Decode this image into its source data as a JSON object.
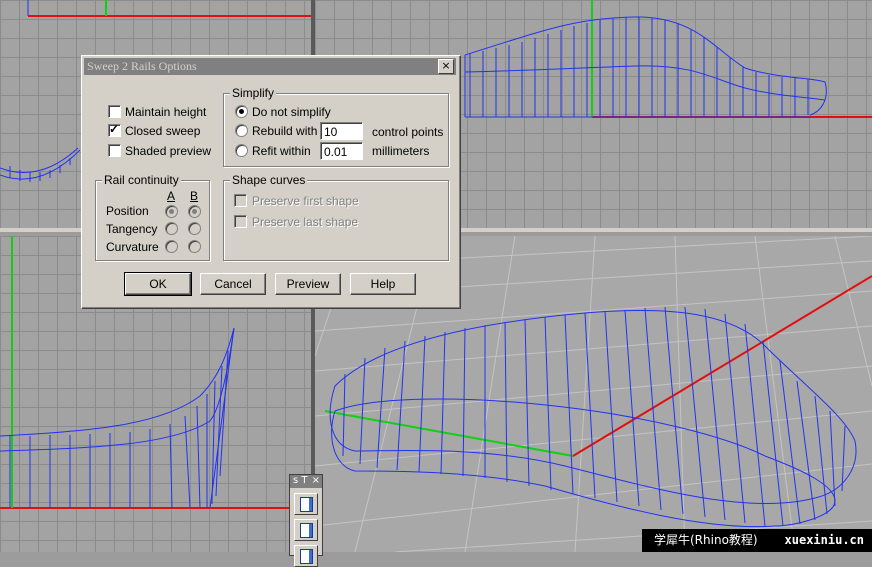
{
  "dialog": {
    "title": "Sweep 2 Rails Options",
    "close_glyph": "×",
    "options": {
      "maintain_height": {
        "label": "Maintain height",
        "checked": false
      },
      "closed_sweep": {
        "label": "Closed sweep",
        "checked": true
      },
      "shaded_preview": {
        "label": "Shaded preview",
        "checked": false
      }
    },
    "simplify": {
      "title": "Simplify",
      "do_not_simplify": "Do not simplify",
      "rebuild_with": "Rebuild with",
      "rebuild_value": "10",
      "rebuild_unit": "control points",
      "refit_within": "Refit within",
      "refit_value": "0.01",
      "refit_unit": "millimeters",
      "selected": "do_not_simplify"
    },
    "rail_continuity": {
      "title": "Rail continuity",
      "col_a": "A",
      "col_b": "B",
      "rows": [
        "Position",
        "Tangency",
        "Curvature"
      ],
      "selected": "Position"
    },
    "shape_curves": {
      "title": "Shape curves",
      "preserve_first": "Preserve first shape",
      "preserve_last": "Preserve last shape"
    },
    "buttons": {
      "ok": "OK",
      "cancel": "Cancel",
      "preview": "Preview",
      "help": "Help"
    }
  },
  "toolbar": {
    "title": "s T",
    "close": "×"
  },
  "watermark": {
    "left": "学犀牛(Rhino教程)",
    "right": "xuexiniu.cn"
  },
  "colors": {
    "wire": "#2233ee",
    "axis_x": "#e01010",
    "axis_y": "#10d010",
    "grid": "#8c8c8c",
    "viewport_bg": "#a3a3a3",
    "dialog_bg": "#d4d0c8"
  }
}
